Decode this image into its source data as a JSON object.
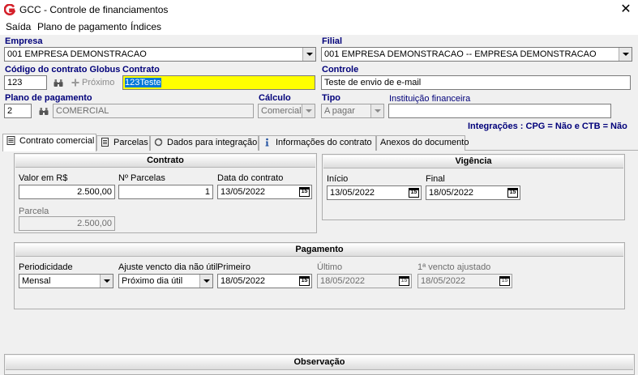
{
  "window": {
    "title": "GCC - Controle de financiamentos",
    "close_glyph": "✕"
  },
  "menu": [
    "Saída",
    "Plano de pagamento",
    "Índices"
  ],
  "header": {
    "empresa_label": "Empresa",
    "empresa_value": "001 EMPRESA DEMONSTRACAO",
    "filial_label": "Filial",
    "filial_value": "001 EMPRESA DEMONSTRACAO -- EMPRESA DEMONSTRACAO",
    "codigo_label": "Código do contrato Globus",
    "codigo_value": "123",
    "next_label": "Próximo",
    "contrato_label": "Contrato",
    "contrato_value": "123Teste",
    "controle_label": "Controle",
    "controle_value": "Teste de envio de e-mail",
    "plano_label": "Plano de pagamento",
    "plano_code": "2",
    "plano_desc": "COMERCIAL",
    "calculo_label": "Cálculo",
    "calculo_value": "Comercial",
    "tipo_label": "Tipo",
    "tipo_value": "A pagar",
    "instituicao_label": "Instituição financeira",
    "instituicao_value": "",
    "integracoes": "Integrações : CPG = Não e CTB = Não"
  },
  "tabs": [
    {
      "label": "Contrato comercial",
      "icon": "document-icon",
      "active": true
    },
    {
      "label": "Parcelas",
      "icon": "list-icon"
    },
    {
      "label": "Dados para integração",
      "icon": "sync-icon"
    },
    {
      "label": "Informações do contrato",
      "icon": "info-icon"
    },
    {
      "label": "Anexos do documento",
      "icon": ""
    }
  ],
  "contrato": {
    "title": "Contrato",
    "valor_label": "Valor em R$",
    "valor_value": "2.500,00",
    "nparcelas_label": "Nº Parcelas",
    "nparcelas_value": "1",
    "data_label": "Data do contrato",
    "data_value": "13/05/2022",
    "parcela_label": "Parcela",
    "parcela_value": "2.500,00"
  },
  "vigencia": {
    "title": "Vigência",
    "inicio_label": "Início",
    "inicio_value": "13/05/2022",
    "final_label": "Final",
    "final_value": "18/05/2022"
  },
  "pagamento": {
    "title": "Pagamento",
    "periodicidade_label": "Periodicidade",
    "periodicidade_value": "Mensal",
    "ajuste_label": "Ajuste vencto dia não útil",
    "ajuste_value": "Próximo dia útil",
    "primeiro_label": "Primeiro",
    "primeiro_value": "18/05/2022",
    "ultimo_label": "Último",
    "ultimo_value": "18/05/2022",
    "vencto_ajustado_label": "1ª vencto ajustado",
    "vencto_ajustado_value": "18/05/2022"
  },
  "observacao": {
    "title": "Observação"
  },
  "calendar_glyph": "15"
}
